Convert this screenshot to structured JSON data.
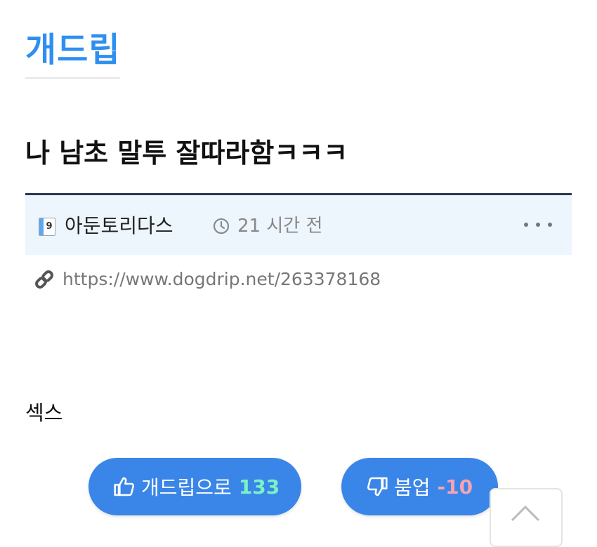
{
  "board": {
    "name": "개드립"
  },
  "post": {
    "title": "나 남초 말투 잘따라함ㅋㅋㅋ",
    "author": {
      "level_badge": "9",
      "name": "아둔토리다스"
    },
    "time_ago": "21 시간 전",
    "permalink": "https://www.dogdrip.net/263378168",
    "body": "섹스"
  },
  "votes": {
    "up": {
      "label": "개드립으로",
      "count": "133",
      "count_color": "#7cf2c4"
    },
    "down": {
      "label": "붐업",
      "count": "-10",
      "count_color": "#f6a3b3"
    }
  },
  "colors": {
    "accent": "#2f8ff0",
    "button": "#3a86e8",
    "meta_bg": "#edf5fd",
    "meta_border": "#2b3850"
  },
  "icons": [
    "clock-icon",
    "more-icon",
    "link-icon",
    "thumbs-up-icon",
    "thumbs-down-icon",
    "chevron-up-icon"
  ]
}
